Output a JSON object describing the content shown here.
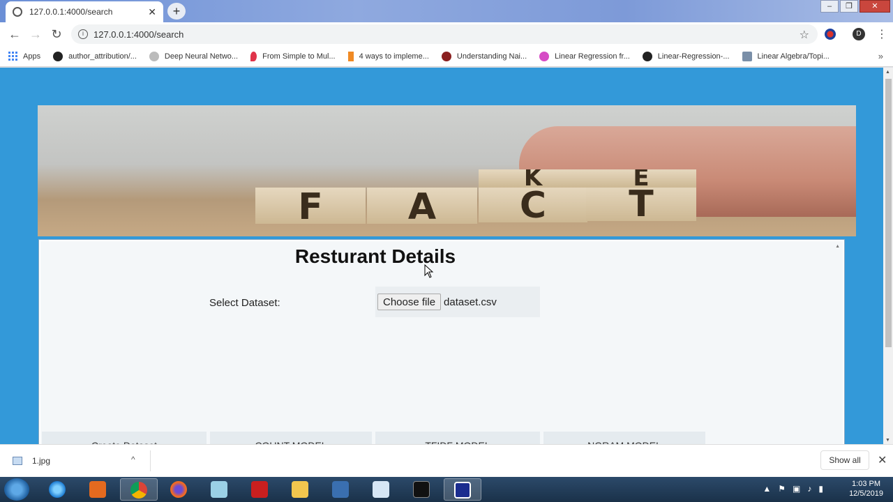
{
  "browser": {
    "tab_title": "127.0.0.1:4000/search",
    "tab_close": "✕",
    "new_tab": "+",
    "url": "127.0.0.1:4000/search",
    "profile_initial": "D"
  },
  "window_controls": {
    "minimize": "–",
    "maximize": "❐",
    "close": "✕"
  },
  "nav": {
    "back": "←",
    "forward": "→",
    "reload": "↻",
    "star": "☆",
    "menu": "⋮"
  },
  "bookmarks": {
    "apps_label": "Apps",
    "items": [
      {
        "label": "author_attribution/...",
        "icon": "github-icon"
      },
      {
        "label": "Deep Neural Netwo...",
        "icon": "globe-icon"
      },
      {
        "label": "From Simple to Mul...",
        "icon": "pin-icon"
      },
      {
        "label": "4 ways to impleme...",
        "icon": "arrow-icon"
      },
      {
        "label": "Understanding Nai...",
        "icon": "person-icon"
      },
      {
        "label": "Linear Regression fr...",
        "icon": "medium-icon"
      },
      {
        "label": "Linear-Regression-...",
        "icon": "github-icon"
      },
      {
        "label": "Linear Algebra/Topi...",
        "icon": "stack-icon"
      }
    ],
    "more": "»"
  },
  "banner": {
    "letters_bottom": [
      "F",
      "A",
      "C",
      "T"
    ],
    "letters_top": [
      "K",
      "E"
    ]
  },
  "form": {
    "heading": "Resturant Details",
    "select_label": "Select Dataset:",
    "choose_button": "Choose file",
    "file_name": "dataset.csv",
    "buttons": [
      "Create Dataset",
      "COUNT MODEL",
      "TFIDF MODEL",
      "NGRAM MODEL"
    ]
  },
  "download_bar": {
    "file": "1.jpg",
    "show_all": "Show all",
    "chevron": "^",
    "close": "✕"
  },
  "taskbar": {
    "time": "1:03 PM",
    "date": "12/5/2019"
  }
}
